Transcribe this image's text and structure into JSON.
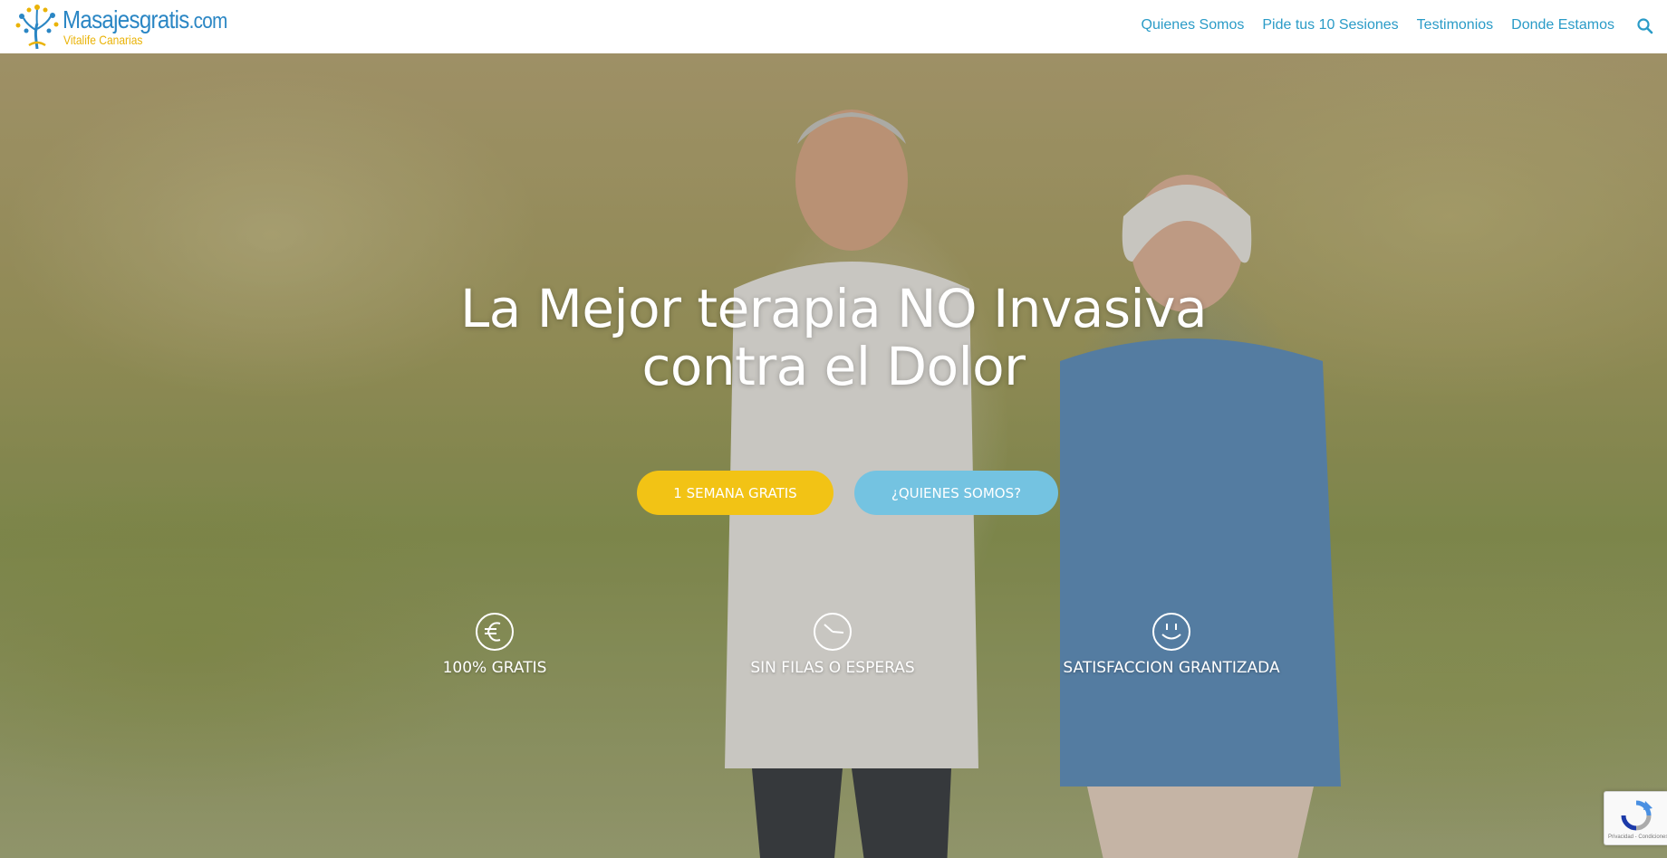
{
  "header": {
    "logo": {
      "brand_main": "Masajesgratis",
      "brand_domain": ".com",
      "brand_sub": "Vitalife Canarias"
    },
    "nav": [
      {
        "label": "Quienes Somos"
      },
      {
        "label": "Pide tus 10 Sesiones"
      },
      {
        "label": "Testimonios"
      },
      {
        "label": "Donde Estamos"
      }
    ],
    "search_icon": "search-icon"
  },
  "hero": {
    "title_line1": "La Mejor terapia NO Invasiva",
    "title_line2": "contra el Dolor",
    "buttons": {
      "primary_label": "1 SEMANA GRATIS",
      "secondary_label": "¿QUIENES SOMOS?"
    },
    "features": [
      {
        "icon": "euro-icon",
        "label": "100% GRATIS"
      },
      {
        "icon": "clock-icon",
        "label": "SIN FILAS O ESPERAS"
      },
      {
        "icon": "smiley-icon",
        "label": "SATISFACCION GRANTIZADA"
      }
    ]
  },
  "recaptcha": {
    "footer_text": "Privacidad - Condiciones"
  },
  "colors": {
    "nav_link": "#2a9bc7",
    "logo_blue": "#2a86c4",
    "logo_yellow": "#eab307",
    "button_yellow": "#f2c315",
    "button_blue": "#74c3e1"
  }
}
